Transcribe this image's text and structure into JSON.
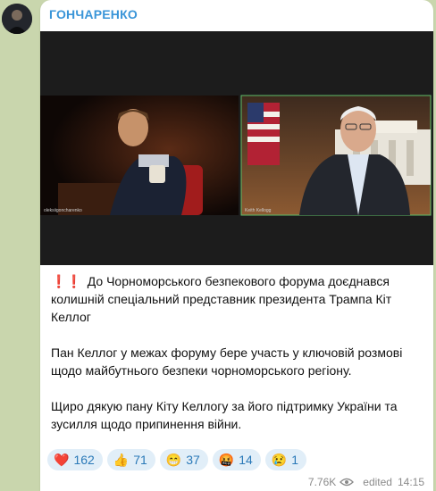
{
  "channel": {
    "name": "ГОНЧАРЕНКО"
  },
  "message": {
    "alert_icons": "❗❗",
    "paragraphs": [
      "До Чорноморського безпекового форума доєднався колишній спеціальний представник президента Трампа Кіт Келлог",
      "Пан Келлог у межах форуму бере участь у ключовій розмові щодо майбутнього безпеки чорноморського регіону.",
      "Щиро дякую пану Кіту Келлогу за його підтримку України та зусилля щодо припинення війни."
    ],
    "reactions": [
      {
        "emoji": "❤️",
        "count": "162"
      },
      {
        "emoji": "👍",
        "count": "71"
      },
      {
        "emoji": "😁",
        "count": "37"
      },
      {
        "emoji": "🤬",
        "count": "14"
      },
      {
        "emoji": "😢",
        "count": "1"
      }
    ],
    "views": "7.76K",
    "edited_label": "edited",
    "time": "14:15"
  },
  "colors": {
    "background": "#c9d6ad",
    "accent": "#3a95d8",
    "reaction_bg": "#e1eef8",
    "reaction_text": "#2a79b8"
  },
  "icons": {
    "views": "eye-icon"
  }
}
